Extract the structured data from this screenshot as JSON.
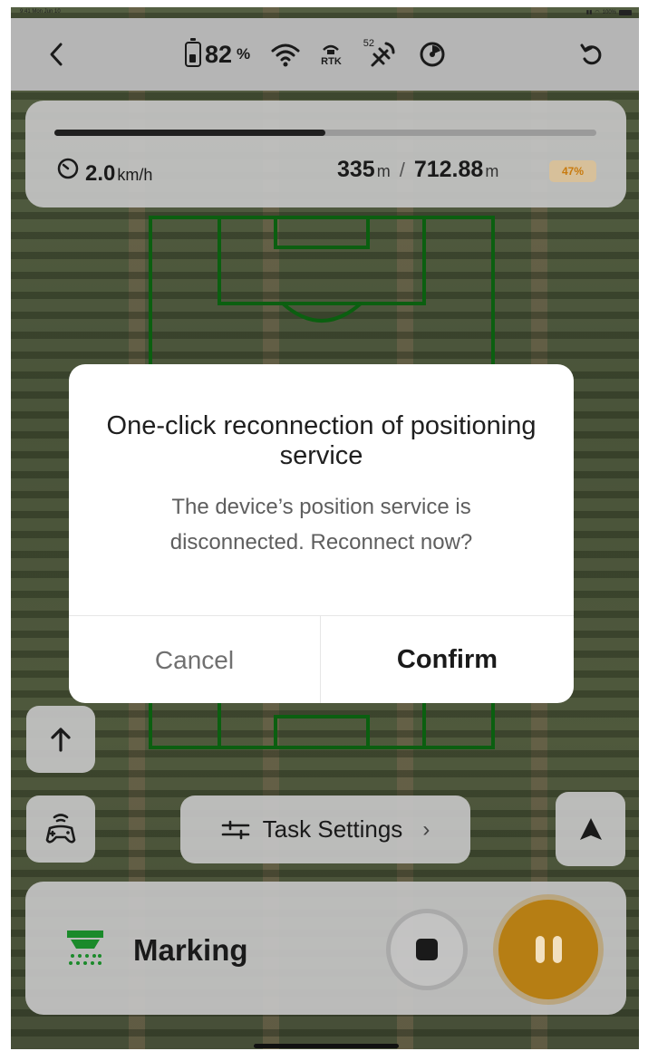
{
  "status_bar": {
    "time": "9:41 Mon Jun 10",
    "battery": "100%"
  },
  "top_bar": {
    "back_icon": "chevron-left-icon",
    "battery_value": "82",
    "battery_unit": "%",
    "wifi_icon": "wifi-icon",
    "rtk_label": "RTK",
    "satellite_count": "52",
    "satellite_icon": "satellite-icon",
    "signal_icon": "radar-signal-icon",
    "refresh_icon": "undo-icon"
  },
  "progress": {
    "fraction": 0.5,
    "speed_value": "2.0",
    "speed_unit": "km/h",
    "done_value": "335",
    "done_unit": "m",
    "separator": "/",
    "total_value": "712.88",
    "total_unit": "m",
    "percent": "47%"
  },
  "task_settings": {
    "label": "Task Settings",
    "chevron": "›"
  },
  "bottom": {
    "mode_label": "Marking"
  },
  "dialog": {
    "title": "One-click reconnection of positioning service",
    "message": "The device’s position service is disconnected. Reconnect now?",
    "cancel_label": "Cancel",
    "confirm_label": "Confirm"
  },
  "colors": {
    "accent": "#E8A21C",
    "field_lines": "#0F8A17",
    "badge_text": "#D88A12"
  }
}
